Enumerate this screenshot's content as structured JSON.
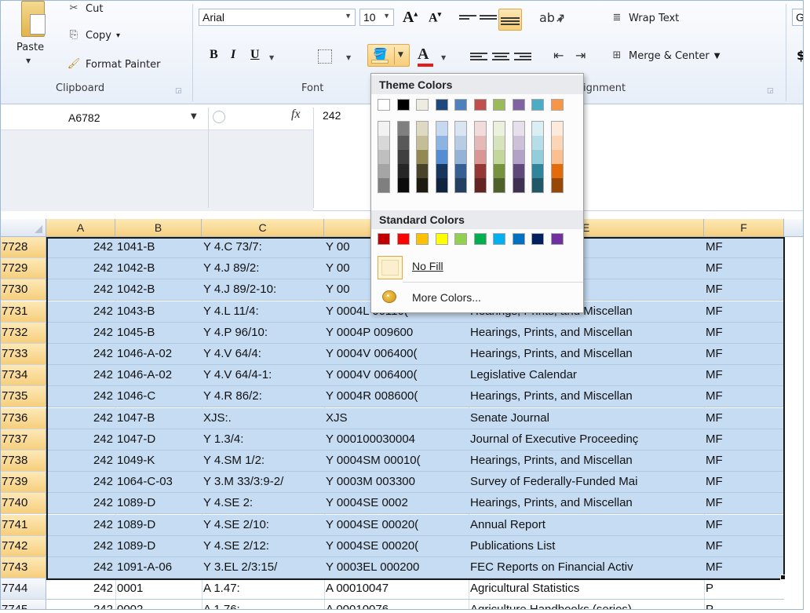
{
  "ribbon": {
    "clipboard": {
      "paste_label": "Paste",
      "cut_label": "Cut",
      "copy_label": "Copy",
      "copy_arrow": "▾",
      "format_painter_label": "Format Painter",
      "group_label": "Clipboard"
    },
    "font": {
      "font_name": "Arial",
      "font_size": "10",
      "bold": "B",
      "italic": "I",
      "underline": "U",
      "group_label": "Font"
    },
    "alignment": {
      "wrap_text_label": "Wrap Text",
      "merge_center_label": "Merge & Center",
      "group_label": "ignment"
    },
    "number": {
      "format_partial": "Ge",
      "currency_symbol": "$"
    }
  },
  "formula_bar": {
    "name_box": "A6782",
    "fx": "fx",
    "value": "242"
  },
  "fill_dropdown": {
    "theme_title": "Theme Colors",
    "standard_title": "Standard Colors",
    "no_fill_label": "No Fill",
    "more_colors_label": "More Colors...",
    "theme_top": [
      "#ffffff",
      "#000000",
      "#eeece1",
      "#1f497d",
      "#4f81bd",
      "#c0504d",
      "#9bbb59",
      "#8064a2",
      "#4bacc6",
      "#f79646"
    ],
    "theme_shades": [
      [
        "#f2f2f2",
        "#d8d8d8",
        "#bfbfbf",
        "#a5a5a5",
        "#7f7f7f"
      ],
      [
        "#7f7f7f",
        "#595959",
        "#3f3f3f",
        "#262626",
        "#0c0c0c"
      ],
      [
        "#ddd9c3",
        "#c4bd97",
        "#938953",
        "#494429",
        "#1d1b10"
      ],
      [
        "#c6d9f0",
        "#8db3e2",
        "#548dd4",
        "#17365d",
        "#0f243e"
      ],
      [
        "#dbe5f1",
        "#b8cce4",
        "#95b3d7",
        "#366092",
        "#244061"
      ],
      [
        "#f2dcdb",
        "#e5b9b7",
        "#d99694",
        "#953734",
        "#632423"
      ],
      [
        "#ebf1dd",
        "#d7e3bc",
        "#c3d69b",
        "#76923c",
        "#4f6128"
      ],
      [
        "#e5e0ec",
        "#ccc1d9",
        "#b2a2c7",
        "#5f497a",
        "#3f3151"
      ],
      [
        "#dbeef3",
        "#b7dde8",
        "#92cddc",
        "#31859b",
        "#205867"
      ],
      [
        "#fdeada",
        "#fbd5b5",
        "#fac08f",
        "#e36c09",
        "#974806"
      ]
    ],
    "standard": [
      "#c00000",
      "#ff0000",
      "#ffc000",
      "#ffff00",
      "#92d050",
      "#00b050",
      "#00b0f0",
      "#0070c0",
      "#002060",
      "#7030a0"
    ]
  },
  "grid": {
    "columns": [
      "A",
      "B",
      "C",
      "D",
      "E",
      "F"
    ],
    "rows": [
      {
        "num": "7728",
        "a": "242",
        "b": "1041-B",
        "c": "Y 4.C 73/7:",
        "d": "Y   00",
        "e": "s, and Miscellan",
        "f": "MF"
      },
      {
        "num": "7729",
        "a": "242",
        "b": "1042-B",
        "c": "Y 4.J 89/2:",
        "d": "Y   00",
        "e": "s, and Miscellan",
        "f": "MF"
      },
      {
        "num": "7730",
        "a": "242",
        "b": "1042-B",
        "c": "Y 4.J 89/2-10:",
        "d": "Y   00",
        "e": "dure, Committee",
        "f": "MF"
      },
      {
        "num": "7731",
        "a": "242",
        "b": "1043-B",
        "c": "Y 4.L 11/4:",
        "d": "Y   0004L   00110(",
        "e": "Hearings, Prints, and Miscellan",
        "f": "MF"
      },
      {
        "num": "7732",
        "a": "242",
        "b": "1045-B",
        "c": "Y 4.P 96/10:",
        "d": "Y   0004P   009600",
        "e": "Hearings, Prints, and Miscellan",
        "f": "MF"
      },
      {
        "num": "7733",
        "a": "242",
        "b": "1046-A-02",
        "c": "Y 4.V 64/4:",
        "d": "Y   0004V   006400(",
        "e": "Hearings, Prints, and Miscellan",
        "f": "MF"
      },
      {
        "num": "7734",
        "a": "242",
        "b": "1046-A-02",
        "c": "Y 4.V 64/4-1:",
        "d": "Y   0004V   006400(",
        "e": "Legislative Calendar",
        "f": "MF"
      },
      {
        "num": "7735",
        "a": "242",
        "b": "1046-C",
        "c": "Y 4.R 86/2:",
        "d": "Y   0004R   008600(",
        "e": "Hearings, Prints, and Miscellan",
        "f": "MF"
      },
      {
        "num": "7736",
        "a": "242",
        "b": "1047-B",
        "c": "XJS:.",
        "d": "XJS",
        "e": "Senate Journal",
        "f": "MF"
      },
      {
        "num": "7737",
        "a": "242",
        "b": "1047-D",
        "c": "Y 1.3/4:",
        "d": "Y   000100030004",
        "e": "Journal of Executive Proceedinç",
        "f": "MF"
      },
      {
        "num": "7738",
        "a": "242",
        "b": "1049-K",
        "c": "Y 4.SM 1/2:",
        "d": "Y   0004SM  00010(",
        "e": "Hearings, Prints, and Miscellan",
        "f": "MF"
      },
      {
        "num": "7739",
        "a": "242",
        "b": "1064-C-03",
        "c": "Y 3.M 33/3:9-2/",
        "d": "Y   0003M   003300",
        "e": "Survey of Federally-Funded Mai",
        "f": "MF"
      },
      {
        "num": "7740",
        "a": "242",
        "b": "1089-D",
        "c": "Y 4.SE 2:",
        "d": "Y   0004SE  0002",
        "e": "Hearings, Prints, and Miscellan",
        "f": "MF"
      },
      {
        "num": "7741",
        "a": "242",
        "b": "1089-D",
        "c": "Y 4.SE 2/10:",
        "d": "Y   0004SE  00020(",
        "e": "Annual Report",
        "f": "MF"
      },
      {
        "num": "7742",
        "a": "242",
        "b": "1089-D",
        "c": "Y 4.SE 2/12:",
        "d": "Y   0004SE  00020(",
        "e": "Publications List",
        "f": "MF"
      },
      {
        "num": "7743",
        "a": "242",
        "b": "1091-A-06",
        "c": "Y 3.EL 2/3:15/",
        "d": "Y   0003EL  000200",
        "e": "FEC Reports on Financial Activ",
        "f": "MF"
      },
      {
        "num": "7744",
        "a": "242",
        "b": "0001",
        "c": "A 1.47:",
        "d": "A   00010047",
        "e": "Agricultural Statistics",
        "f": "P"
      },
      {
        "num": "7745",
        "a": "242",
        "b": "0002",
        "c": "A 1.76:",
        "d": "A   00010076",
        "e": "Agriculture Handbooks (series)",
        "f": "P"
      }
    ]
  }
}
